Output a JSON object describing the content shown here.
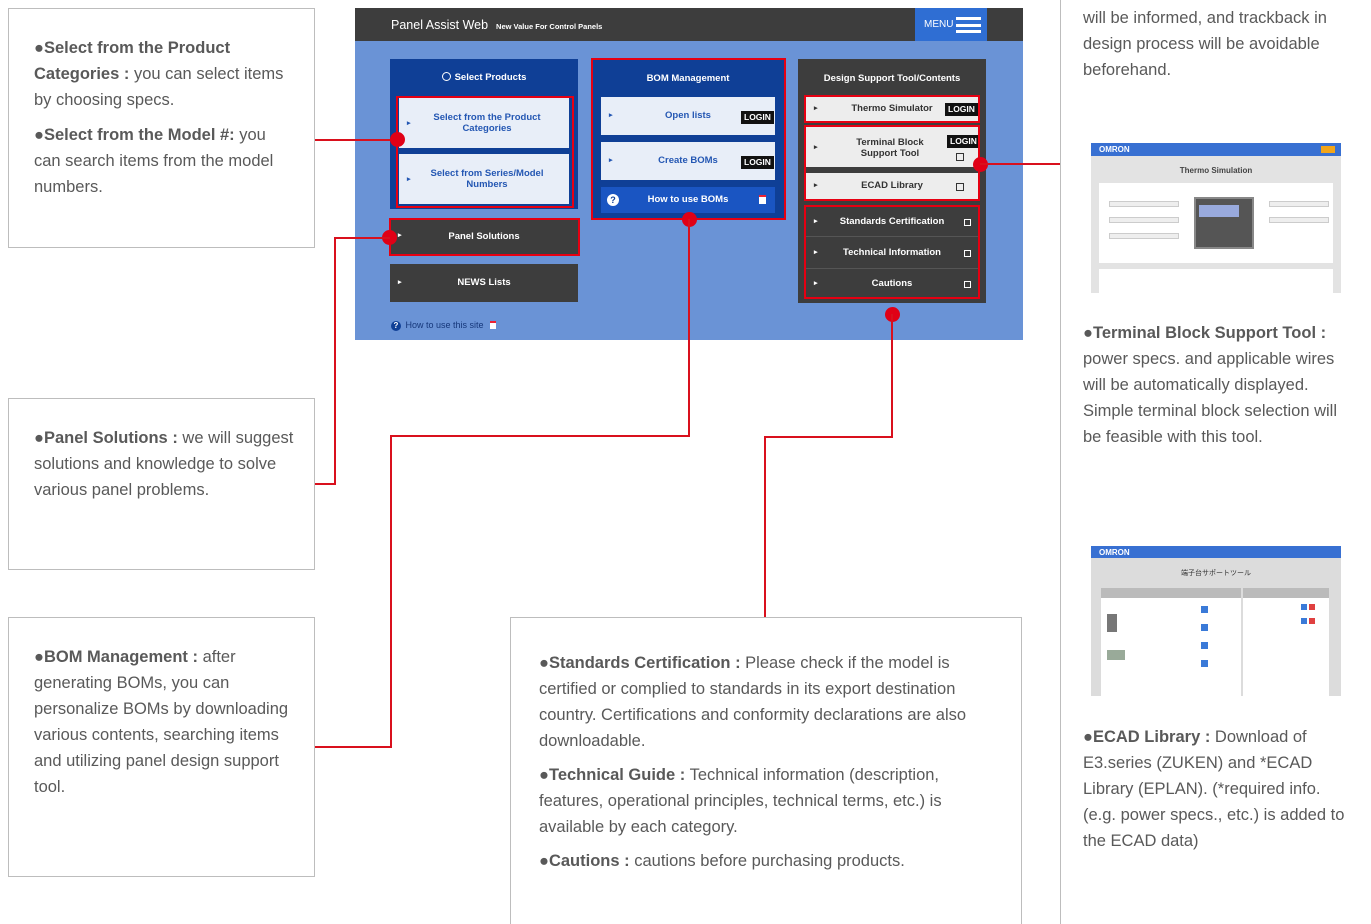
{
  "screenshot": {
    "app_title": "Panel Assist Web",
    "tagline": "New Value For Control Panels",
    "menu_label": "MENU",
    "select_products": {
      "title": "Select Products",
      "items": [
        "Select from the Product Categories",
        "Select from Series/Model Numbers"
      ]
    },
    "panel_solutions": "Panel Solutions",
    "news_lists": "NEWS Lists",
    "how_to_use_site": "How to use this site",
    "bom": {
      "title": "BOM Management",
      "open_lists": "Open lists",
      "create_boms": "Create BOMs",
      "how_to_use": "How to use BOMs",
      "login": "LOGIN"
    },
    "design": {
      "title": "Design Support Tool/Contents",
      "thermo": "Thermo Simulator",
      "terminal": "Terminal Block Support Tool",
      "ecad": "ECAD Library",
      "standards": "Standards Certification",
      "technical": "Technical Information",
      "cautions": "Cautions"
    }
  },
  "callouts": {
    "select": {
      "h1": "●Select from the Product Categories :",
      "t1": " you can select items by choosing specs.",
      "h2": "●Select from the Model #:",
      "t2": " you can search items from the model numbers."
    },
    "panel": {
      "h": "●Panel Solutions :",
      "t": " we will suggest solutions and knowledge to solve various panel problems."
    },
    "bom": {
      "h": "●BOM Management :",
      "t": " after generating BOMs, you can personalize BOMs by downloading various contents, searching items and utilizing panel design support tool."
    },
    "standards": {
      "h1": "●Standards Certification :",
      "t1": " Please check if the model is certified or complied to standards in its export destination country. Certifications and conformity declarations are also downloadable.",
      "h2": "●Technical Guide :",
      "t2": " Technical information (description, features, operational principles, technical terms, etc.) is available by each category.",
      "h3": "●Cautions :",
      "t3": " cautions before purchasing products."
    }
  },
  "right_column": {
    "thermo_tail": "will be informed, and trackback in design process will be avoidable beforehand.",
    "thumb1_title": "Thermo Simulation",
    "thumb1_brand": "OMRON",
    "terminal_h": "●Terminal Block Support Tool :",
    "terminal_t": " power specs. and applicable wires will be automatically displayed. Simple terminal block selection will be feasible with this tool.",
    "thumb2_title": "端子台サポートツール",
    "thumb2_brand": "OMRON",
    "ecad_h": "●ECAD Library :",
    "ecad_t": " Download of E3.series (ZUKEN) and *ECAD Library (EPLAN). (*required info. (e.g. power specs., etc.)  is added to the ECAD data)"
  },
  "colors": {
    "accent_red": "#e60012",
    "bg_blue": "#6a93d6",
    "panel_navy": "#0f3f96",
    "dark_gray": "#3d3d3d"
  }
}
